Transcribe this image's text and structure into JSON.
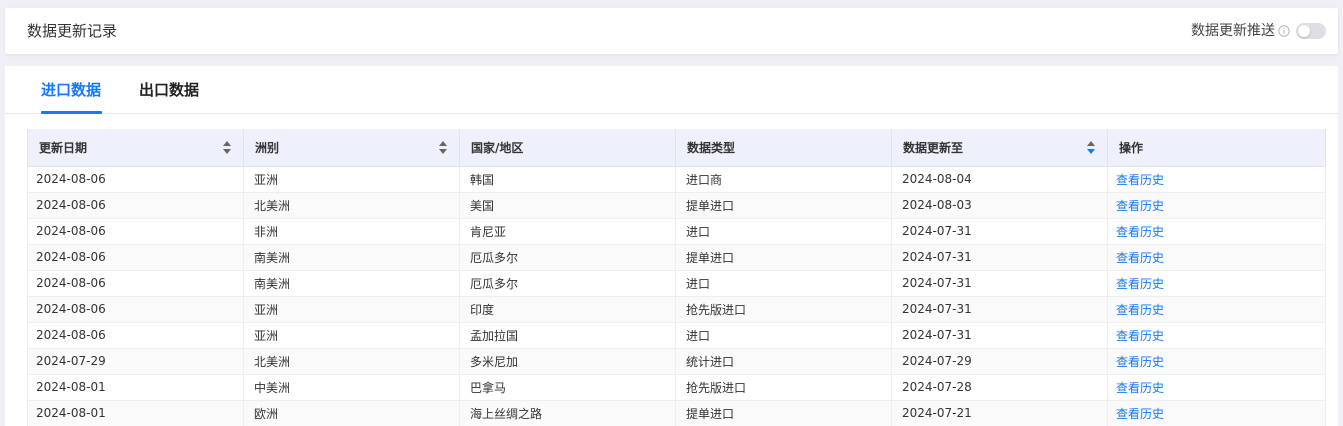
{
  "header": {
    "title": "数据更新记录",
    "push_label": "数据更新推送",
    "push_enabled": false
  },
  "tabs": [
    {
      "label": "进口数据",
      "active": true
    },
    {
      "label": "出口数据",
      "active": false
    }
  ],
  "table": {
    "columns": [
      {
        "label": "更新日期",
        "sortable": true
      },
      {
        "label": "洲别",
        "sortable": true
      },
      {
        "label": "国家/地区",
        "sortable": false
      },
      {
        "label": "数据类型",
        "sortable": false
      },
      {
        "label": "数据更新至",
        "sortable": true
      },
      {
        "label": "操作",
        "sortable": false
      }
    ],
    "action_label": "查看历史",
    "rows": [
      [
        "2024-08-06",
        "亚洲",
        "韩国",
        "进口商",
        "2024-08-04"
      ],
      [
        "2024-08-06",
        "北美洲",
        "美国",
        "提单进口",
        "2024-08-03"
      ],
      [
        "2024-08-06",
        "非洲",
        "肯尼亚",
        "进口",
        "2024-07-31"
      ],
      [
        "2024-08-06",
        "南美洲",
        "厄瓜多尔",
        "提单进口",
        "2024-07-31"
      ],
      [
        "2024-08-06",
        "南美洲",
        "厄瓜多尔",
        "进口",
        "2024-07-31"
      ],
      [
        "2024-08-06",
        "亚洲",
        "印度",
        "抢先版进口",
        "2024-07-31"
      ],
      [
        "2024-08-06",
        "亚洲",
        "孟加拉国",
        "进口",
        "2024-07-31"
      ],
      [
        "2024-07-29",
        "北美洲",
        "多米尼加",
        "统计进口",
        "2024-07-29"
      ],
      [
        "2024-08-01",
        "中美洲",
        "巴拿马",
        "抢先版进口",
        "2024-07-28"
      ],
      [
        "2024-08-01",
        "欧洲",
        "海上丝绸之路",
        "提单进口",
        "2024-07-21"
      ]
    ]
  },
  "colors": {
    "accent": "#1677ff",
    "header_bg": "#eef1fb"
  }
}
